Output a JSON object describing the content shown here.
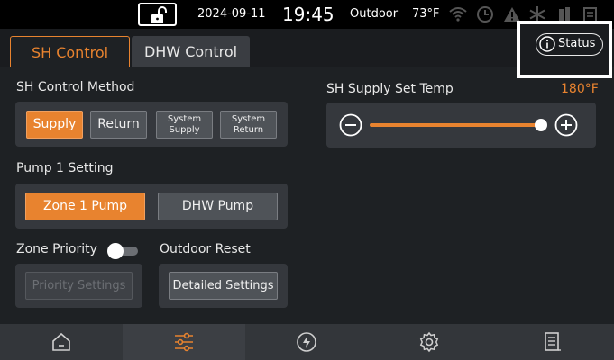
{
  "status_bar": {
    "lock_icon": "unlocked-padlock-icon",
    "date": "2024-09-11",
    "time": "19:45",
    "outdoor_label": "Outdoor",
    "outdoor_temp": "73°F",
    "icons": [
      "wifi-icon",
      "clock-icon",
      "warning-icon",
      "snowflake-icon",
      "boiler-icon",
      "log-icon"
    ]
  },
  "tabs": [
    {
      "label": "SH Control",
      "active": true
    },
    {
      "label": "DHW Control",
      "active": false
    }
  ],
  "status_button": {
    "label": "Status",
    "icon": "info-icon"
  },
  "sh_control_method": {
    "label": "SH Control Method",
    "options": [
      {
        "label": "Supply",
        "active": true
      },
      {
        "label": "Return",
        "active": false
      },
      {
        "line1": "System",
        "line2": "Supply",
        "active": false
      },
      {
        "line1": "System",
        "line2": "Return",
        "active": false
      }
    ]
  },
  "pump_setting": {
    "label": "Pump 1 Setting",
    "options": [
      {
        "label": "Zone 1 Pump",
        "active": true
      },
      {
        "label": "DHW Pump",
        "active": false
      }
    ]
  },
  "zone_priority": {
    "label": "Zone Priority",
    "enabled": false,
    "button_label": "Priority Settings"
  },
  "outdoor_reset": {
    "label": "Outdoor Reset",
    "button_label": "Detailed Settings"
  },
  "supply_set_temp": {
    "label": "SH Supply Set Temp",
    "value": "180°F",
    "slider_fraction": 1.0,
    "decrease_icon": "minus-circle-icon",
    "increase_icon": "plus-circle-icon"
  },
  "bottom_nav": [
    {
      "icon": "home-icon",
      "active": false
    },
    {
      "icon": "sliders-icon",
      "active": true
    },
    {
      "icon": "power-icon",
      "active": false
    },
    {
      "icon": "gear-icon",
      "active": false
    },
    {
      "icon": "document-icon",
      "active": false
    }
  ],
  "colors": {
    "accent": "#e8832f",
    "background": "#1e2124",
    "panel": "#35383d",
    "button": "#4f5358"
  }
}
